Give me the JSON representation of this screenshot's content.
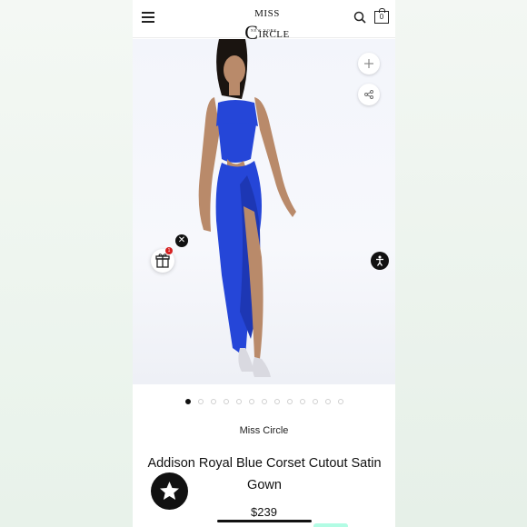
{
  "header": {
    "brand_logo_text": "MISS CIRCLE",
    "brand_logo_sub": "NEW YORK",
    "cart_count": "0"
  },
  "gallery": {
    "slides_total": 13,
    "active_index": 0,
    "gift_badge_count": "1",
    "close_symbol": "✕"
  },
  "product": {
    "brand": "Miss Circle",
    "title": "Addison Royal Blue Corset Cutout Satin Gown",
    "price": "$239"
  },
  "colors": {
    "gown": "#2546d8",
    "badge": "#d62020",
    "accent_dark": "#111111"
  },
  "icons": [
    "menu-icon",
    "search-icon",
    "bag-icon",
    "plus-icon",
    "share-icon",
    "gift-icon",
    "close-icon",
    "accessibility-icon",
    "star-icon"
  ]
}
